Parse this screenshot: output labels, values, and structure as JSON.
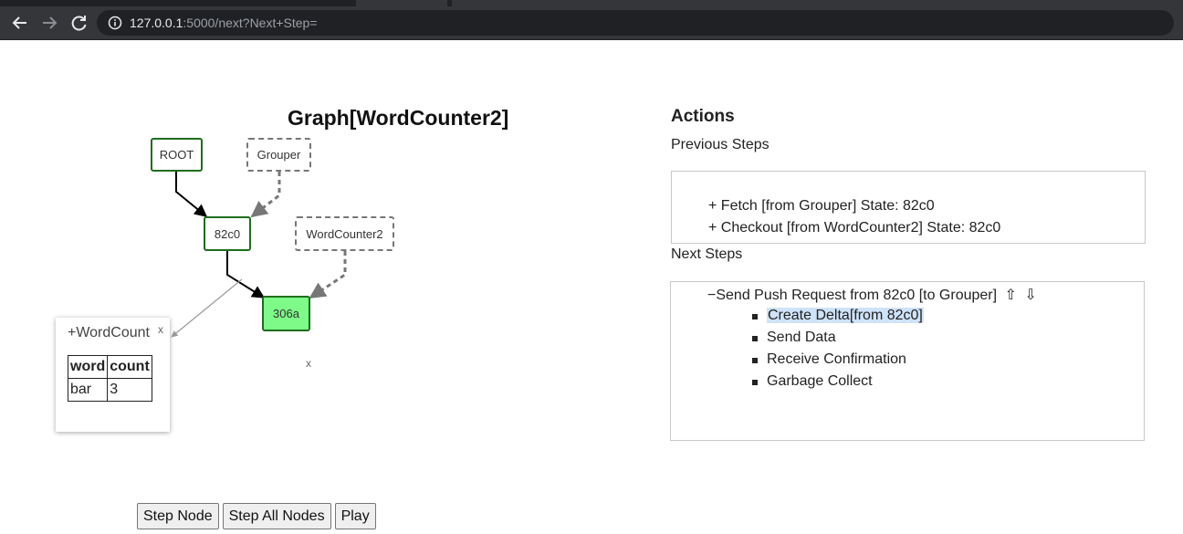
{
  "browser": {
    "url_host": "127.0.0.1",
    "url_rest": ":5000/next?Next+Step=",
    "back_icon": "back-arrow-icon",
    "forward_icon": "forward-arrow-icon",
    "reload_icon": "reload-icon",
    "info_icon": "info-icon"
  },
  "graph": {
    "title": "Graph[WordCounter2]",
    "nodes": {
      "root": "ROOT",
      "grouper": "Grouper",
      "n82c0": "82c0",
      "wordcounter2": "WordCounter2",
      "n306a": "306a"
    },
    "popup": {
      "title": "+WordCount",
      "close": "x",
      "headers": [
        "word",
        "count"
      ],
      "rows": [
        [
          "bar",
          "3"
        ]
      ]
    },
    "stray_close": "x",
    "colors": {
      "active_node": "#7dfa88",
      "node_border": "#1e6e1e"
    }
  },
  "controls": {
    "step_node": "Step Node",
    "step_all": "Step All Nodes",
    "play": "Play"
  },
  "actions": {
    "title": "Actions",
    "previous_label": "Previous Steps",
    "previous_steps": [
      "+ Fetch [from Grouper] State: 82c0",
      "+ Checkout [from WordCounter2] State: 82c0"
    ],
    "next_label": "Next Steps",
    "next_step": {
      "title": "−Send Push Request from 82c0 [to Grouper]",
      "up_arrow": "⇧",
      "down_arrow": "⇩",
      "substeps": [
        "Create Delta[from 82c0]",
        "Send Data",
        "Receive Confirmation",
        "Garbage Collect"
      ]
    }
  }
}
